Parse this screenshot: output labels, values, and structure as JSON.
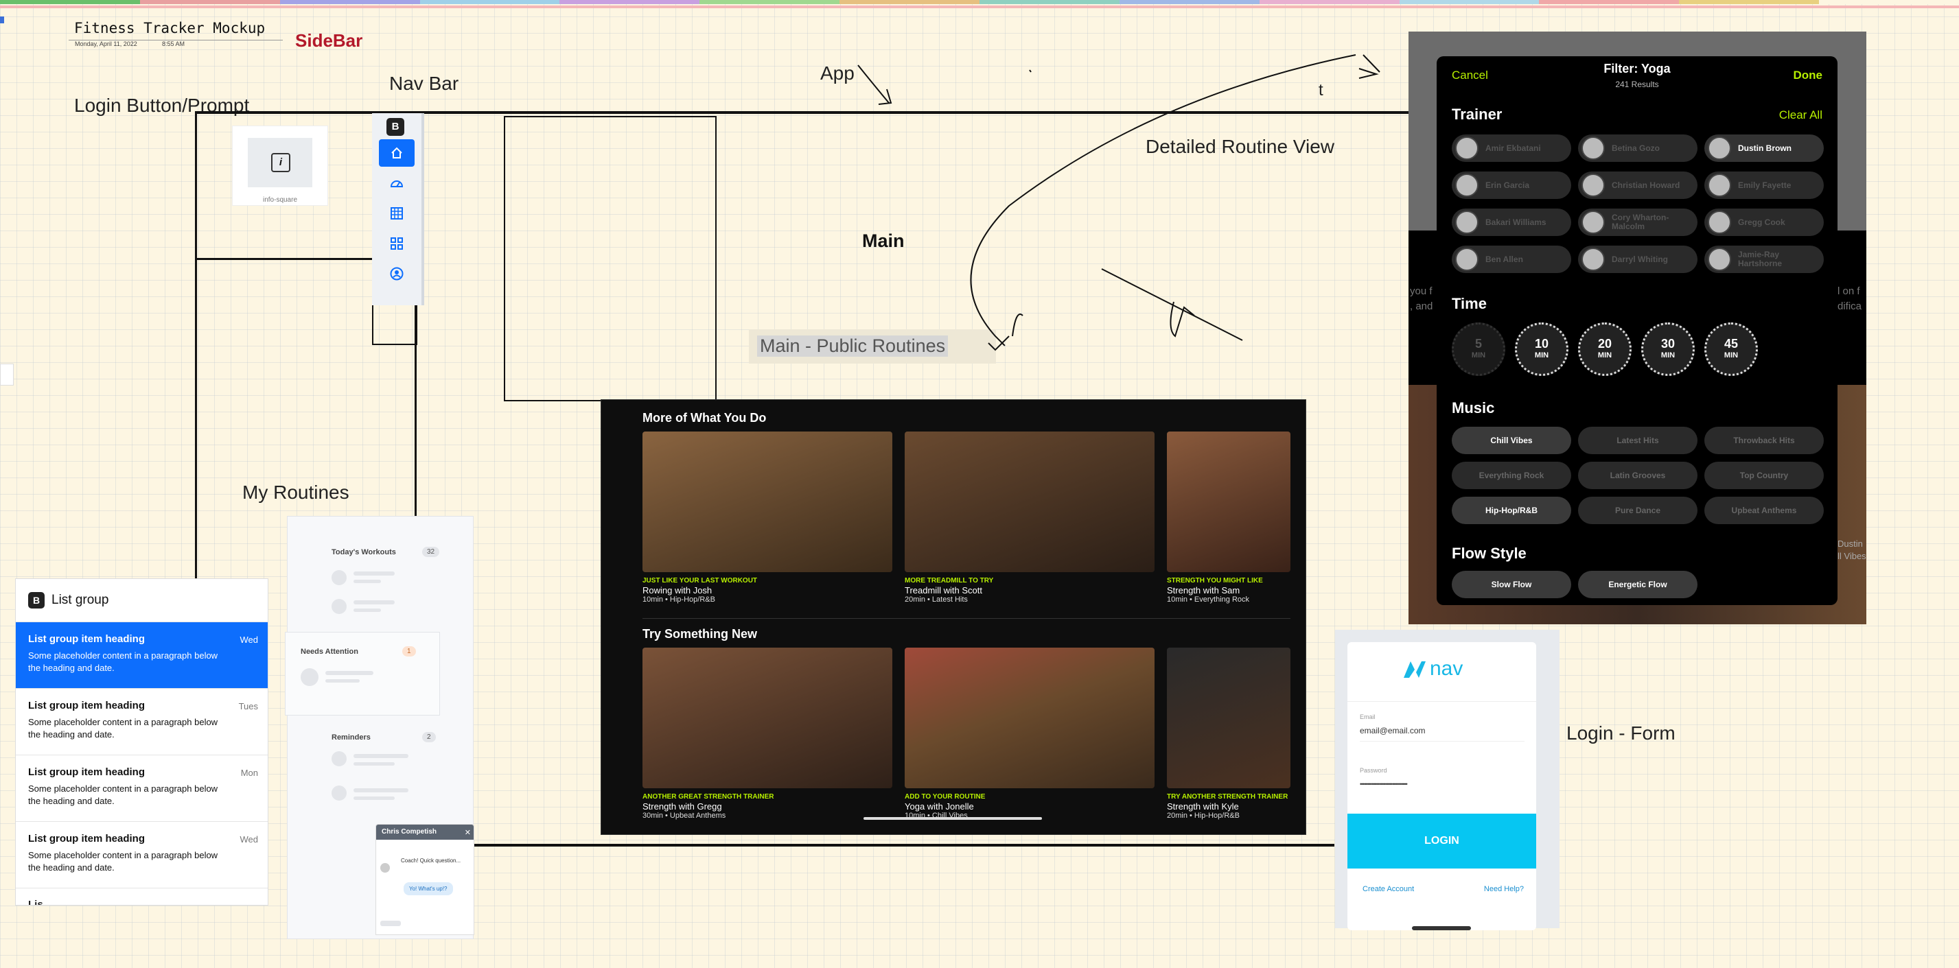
{
  "header": {
    "title": "Fitness Tracker Mockup",
    "date": "Monday, April 11, 2022",
    "time": "8:55 AM",
    "sidebar_label": "SideBar"
  },
  "labels": {
    "login_prompt": "Login Button/Prompt",
    "nav_bar": "Nav Bar",
    "app": "App",
    "t": "t",
    "detailed_routine": "Detailed Routine View",
    "main": "Main",
    "main_public": "Main  - Public Routines",
    "my_routines": "My Routines",
    "login_form": "Login - Form"
  },
  "info_box": {
    "caption": "info-square",
    "icon": "info-square-icon"
  },
  "sidebar": {
    "brand": "B",
    "items": [
      "home-icon",
      "speedometer-icon",
      "table-icon",
      "grid-icon",
      "person-circle-icon"
    ]
  },
  "fitness": {
    "sections": [
      {
        "title": "More of What You Do",
        "tiles": [
          {
            "tag": "JUST LIKE YOUR LAST WORKOUT",
            "title": "Rowing with Josh",
            "sub": "10min • Hip-Hop/R&B",
            "color": "#6b4a2c"
          },
          {
            "tag": "MORE TREADMILL TO TRY",
            "title": "Treadmill with Scott",
            "sub": "20min • Latest Hits",
            "color": "#5a3a25"
          },
          {
            "tag": "STRENGTH YOU MIGHT LIKE",
            "title": "Strength with Sam",
            "sub": "10min • Everything Rock",
            "color": "#7a4a32"
          }
        ]
      },
      {
        "title": "Try Something New",
        "tiles": [
          {
            "tag": "ANOTHER GREAT STRENGTH TRAINER",
            "title": "Strength with Gregg",
            "sub": "30min • Upbeat Anthems",
            "color": "#5b3a28"
          },
          {
            "tag": "ADD TO YOUR ROUTINE",
            "title": "Yoga with Jonelle",
            "sub": "10min • Chill Vibes",
            "color": "#6a4a30"
          },
          {
            "tag": "TRY ANOTHER STRENGTH TRAINER",
            "title": "Strength with Kyle",
            "sub": "20min • Hip-Hop/R&B",
            "color": "#3a2a22"
          }
        ]
      }
    ]
  },
  "filter": {
    "cancel": "Cancel",
    "title": "Filter: Yoga",
    "results": "241 Results",
    "done": "Done",
    "trainer_heading": "Trainer",
    "clear_all": "Clear All",
    "trainers": [
      {
        "name": "Amir Ekbatani",
        "on": false
      },
      {
        "name": "Betina Gozo",
        "on": false
      },
      {
        "name": "Dustin Brown",
        "on": true
      },
      {
        "name": "Erin Garcia",
        "on": false
      },
      {
        "name": "Christian Howard",
        "on": false
      },
      {
        "name": "Emily Fayette",
        "on": false
      },
      {
        "name": "Bakari Williams",
        "on": false
      },
      {
        "name": "Cory Wharton-Malcolm",
        "on": false
      },
      {
        "name": "Gregg Cook",
        "on": false
      },
      {
        "name": "Ben Allen",
        "on": false
      },
      {
        "name": "Darryl Whiting",
        "on": false
      },
      {
        "name": "Jamie-Ray Hartshorne",
        "on": false
      }
    ],
    "time_heading": "Time",
    "times": [
      {
        "v": "5",
        "u": "MIN",
        "on": false
      },
      {
        "v": "10",
        "u": "MIN",
        "on": true
      },
      {
        "v": "20",
        "u": "MIN",
        "on": true
      },
      {
        "v": "30",
        "u": "MIN",
        "on": true
      },
      {
        "v": "45",
        "u": "MIN",
        "on": true
      }
    ],
    "music_heading": "Music",
    "music": [
      {
        "name": "Chill Vibes",
        "on": true
      },
      {
        "name": "Latest Hits",
        "on": false
      },
      {
        "name": "Throwback Hits",
        "on": false
      },
      {
        "name": "Everything Rock",
        "on": false
      },
      {
        "name": "Latin Grooves",
        "on": false
      },
      {
        "name": "Top Country",
        "on": false
      },
      {
        "name": "Hip-Hop/R&B",
        "on": true
      },
      {
        "name": "Pure Dance",
        "on": false
      },
      {
        "name": "Upbeat Anthems",
        "on": false
      }
    ],
    "flow_heading": "Flow Style",
    "flow": [
      {
        "name": "Slow Flow",
        "on": true
      },
      {
        "name": "Energetic Flow",
        "on": true
      }
    ],
    "bleed_left": "you f\n, and",
    "bleed_right": "l on f\ndifica",
    "bleed_right2": "Dustin\nll Vibes"
  },
  "list_group": {
    "brand": "B",
    "title": "List group",
    "items": [
      {
        "heading": "List group item heading",
        "text": "Some placeholder content in a paragraph below the heading and date.",
        "date": "Wed",
        "active": true
      },
      {
        "heading": "List group item heading",
        "text": "Some placeholder content in a paragraph below the heading and date.",
        "date": "Tues",
        "active": false
      },
      {
        "heading": "List group item heading",
        "text": "Some placeholder content in a paragraph below the heading and date.",
        "date": "Mon",
        "active": false
      },
      {
        "heading": "List group item heading",
        "text": "Some placeholder content in a paragraph below the heading and date.",
        "date": "Wed",
        "active": false
      }
    ]
  },
  "routines_panel": {
    "todays_workouts": "Today's Workouts",
    "todays_count": "32",
    "needs_attention": "Needs Attention",
    "attention_count": "1",
    "reminders": "Reminders",
    "reminders_count": "2",
    "chat_name": "Chris Competish",
    "chat_msg1": "Coach! Quick question...",
    "chat_msg2": "Yo! What's up!?"
  },
  "login": {
    "brand": "nav",
    "email_label": "Email",
    "email_value": "email@email.com",
    "password_label": "Password",
    "password_value": "••••••••••••••••••••••••••••••••",
    "login_button": "LOGIN",
    "create_account": "Create Account",
    "need_help": "Need Help?"
  },
  "colors": {
    "accent_blue": "#0d6efd",
    "neon": "#b7f000",
    "login_cyan": "#06c6f2"
  }
}
